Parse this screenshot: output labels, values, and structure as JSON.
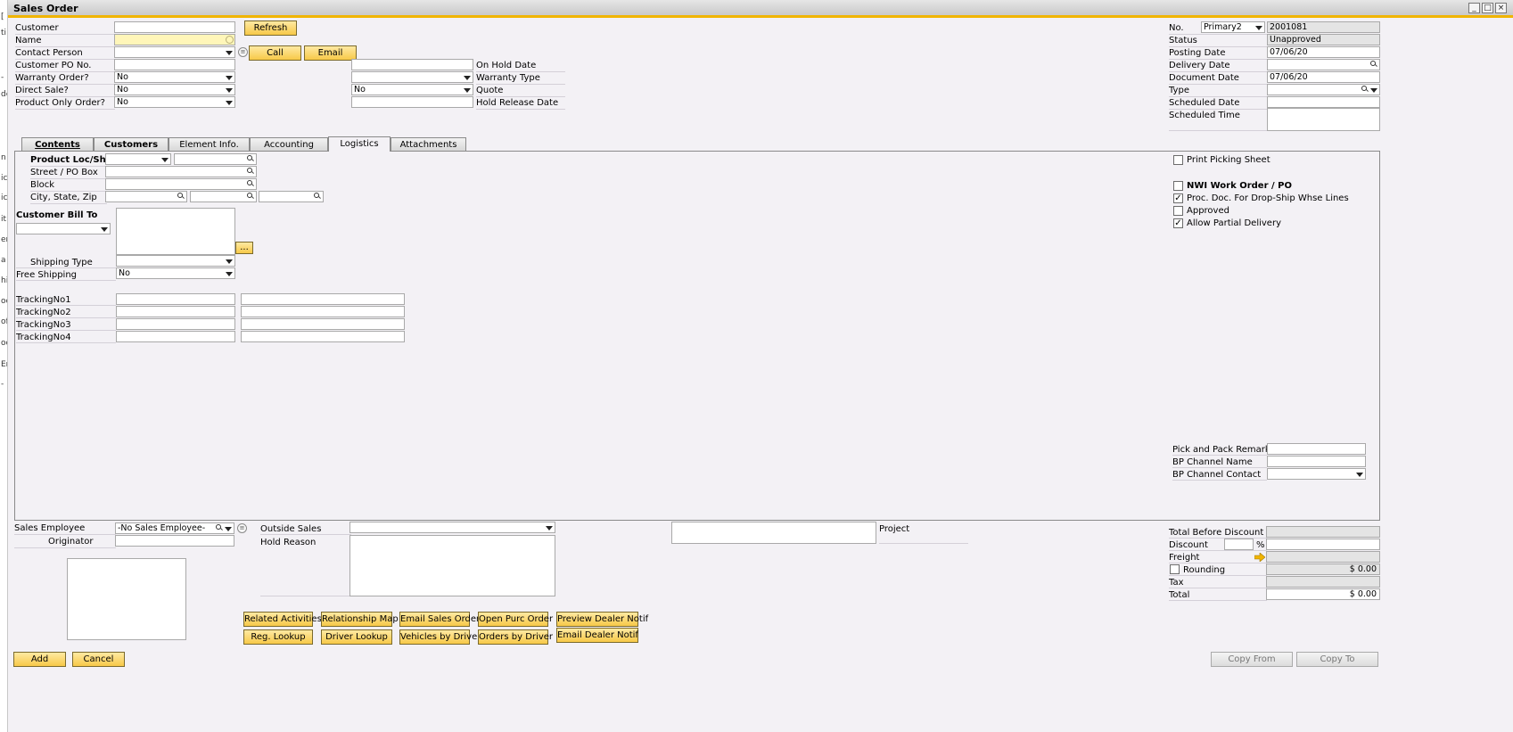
{
  "edge_letters": [
    "[",
    "ti",
    "de",
    "-",
    "n",
    "ic",
    "ic",
    "it",
    "er",
    "a",
    "hi",
    "oc",
    "of",
    "oc",
    "Er",
    "-"
  ],
  "window": {
    "title": "Sales Order",
    "minimize_glyph": "_",
    "maximize_glyph": "□",
    "close_glyph": "×"
  },
  "header": {
    "customer_label": "Customer",
    "customer_value": "",
    "name_label": "Name",
    "name_value": "",
    "contact_person_label": "Contact Person",
    "customer_po_label": "Customer PO No.",
    "warranty_order_label": "Warranty Order?",
    "warranty_order_value": "No",
    "direct_sale_label": "Direct Sale?",
    "direct_sale_value": "No",
    "product_only_label": "Product Only Order?",
    "product_only_value": "No",
    "refresh_label": "Refresh",
    "call_label": "Call",
    "email_label": "Email",
    "on_hold_date_label": "On Hold Date",
    "warranty_type_label": "Warranty Type",
    "quote_label": "Quote",
    "quote_value": "No",
    "hold_release_label": "Hold Release Date"
  },
  "doc": {
    "no_label": "No.",
    "series_value": "Primary2",
    "number_value": "2001081",
    "status_label": "Status",
    "status_value": "Unapproved",
    "posting_date_label": "Posting Date",
    "posting_date_value": "07/06/20",
    "delivery_date_label": "Delivery Date",
    "document_date_label": "Document Date",
    "document_date_value": "07/06/20",
    "type_label": "Type",
    "scheduled_date_label": "Scheduled Date",
    "scheduled_time_label": "Scheduled Time"
  },
  "tabs": [
    "Contents",
    "Customers",
    "Element Info.",
    "Accounting",
    "Logistics",
    "Attachments"
  ],
  "logistics": {
    "product_loc_label": "Product Loc/Ship",
    "street_label": "Street / PO Box",
    "block_label": "Block",
    "city_label": "City, State, Zip",
    "bill_to_label": "Customer Bill To",
    "ellipsis_label": "...",
    "shipping_type_label": "Shipping Type",
    "free_shipping_label": "Free Shipping",
    "free_shipping_value": "No",
    "tracking": [
      "TrackingNo1",
      "TrackingNo2",
      "TrackingNo3",
      "TrackingNo4"
    ],
    "print_picking": "Print Picking Sheet",
    "nwi_work_order": "NWI Work Order / PO",
    "proc_doc": "Proc. Doc. For Drop-Ship Whse Lines",
    "approved": "Approved",
    "allow_partial": "Allow Partial Delivery",
    "checks": {
      "print_picking": false,
      "nwi_work_order": false,
      "proc_doc": true,
      "approved": false,
      "allow_partial": true
    },
    "check_glyph": "✓",
    "pick_pack_label": "Pick and Pack Remarks",
    "bp_channel_name_label": "BP Channel Name",
    "bp_channel_contact_label": "BP Channel Contact"
  },
  "footer": {
    "sales_employee_label": "Sales Employee",
    "sales_employee_value": "-No Sales Employee-",
    "originator_label": "Originator",
    "outside_sales_label": "Outside Sales",
    "hold_reason_label": "Hold Reason",
    "project_label": "Project",
    "total_before_discount_label": "Total Before Discount",
    "discount_label": "Discount",
    "percent": "%",
    "freight_label": "Freight",
    "rounding_label": "Rounding",
    "rounding_value": "$ 0.00",
    "tax_label": "Tax",
    "total_label": "Total",
    "total_value": "$ 0.00",
    "buttons_row1": [
      "Related Activities",
      "Relationship Map",
      "Email Sales Order",
      "Open Purc Order",
      "Preview Dealer Notif"
    ],
    "buttons_row2": [
      "Reg. Lookup",
      "Driver Lookup",
      "Vehicles by Driver",
      "Orders by Driver",
      "Email Dealer Notif"
    ],
    "add_label": "Add",
    "cancel_label": "Cancel",
    "copy_from_label": "Copy From",
    "copy_to_label": "Copy To"
  },
  "colors": {
    "accent": "#f0b400",
    "button": "#f7c948",
    "background": "#f3f1f5"
  }
}
